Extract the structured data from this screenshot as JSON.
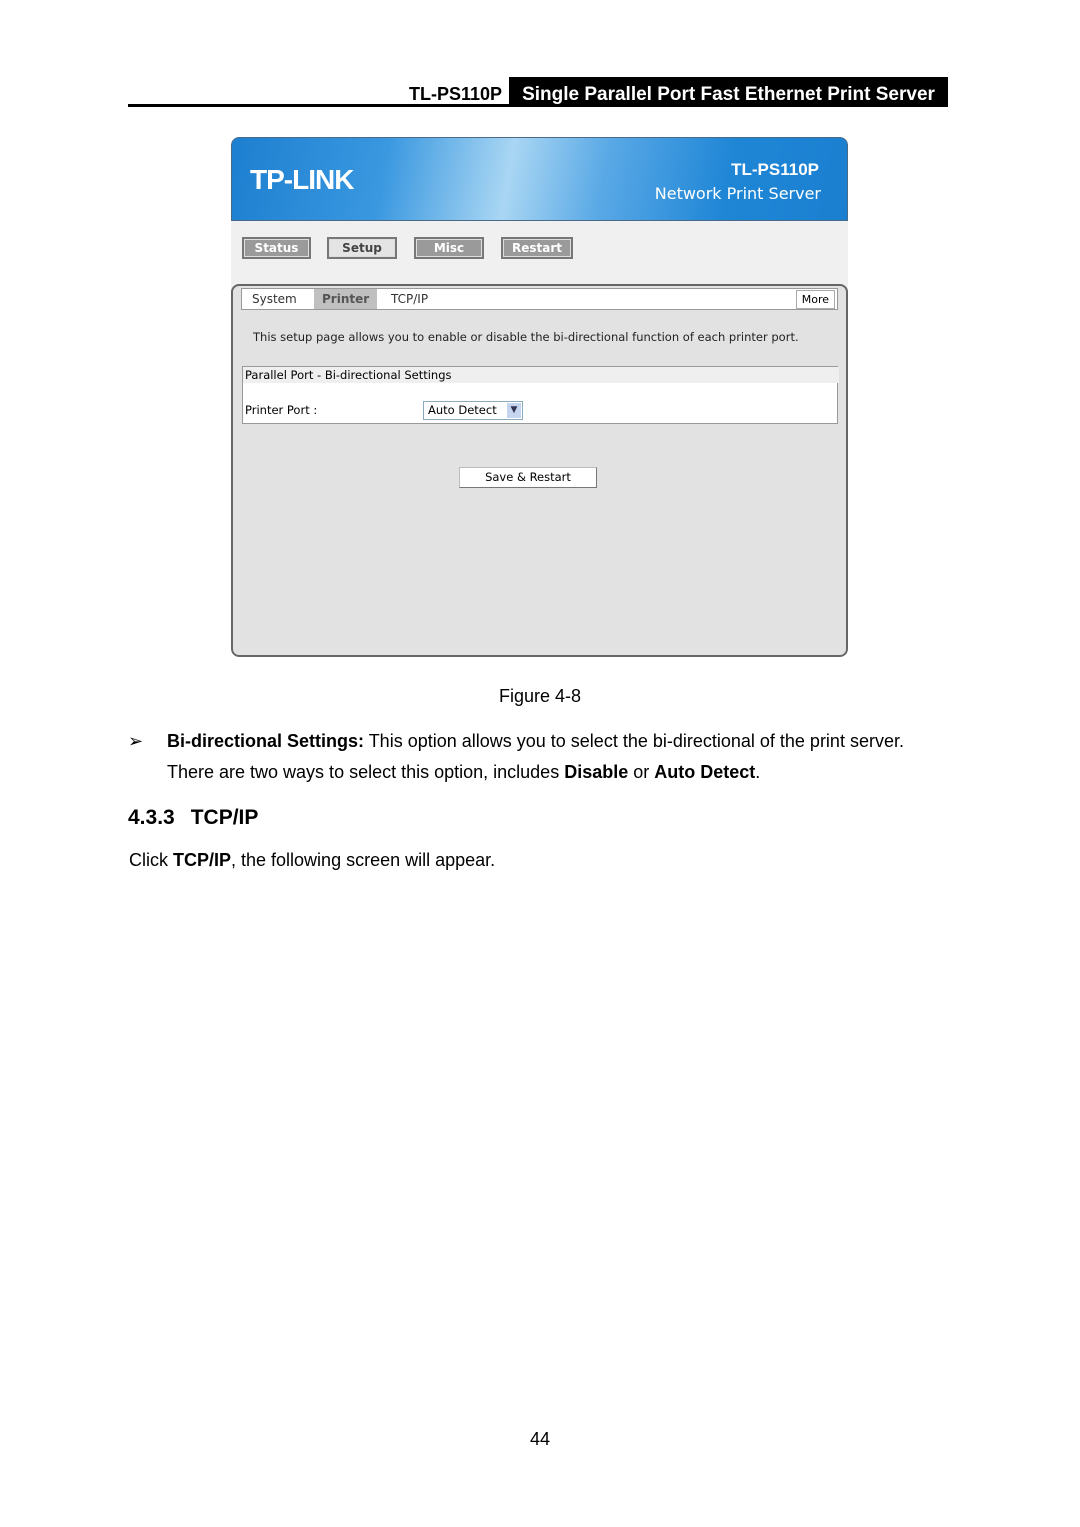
{
  "header": {
    "model": "TL-PS110P",
    "title": "Single Parallel Port Fast Ethernet Print Server"
  },
  "screenshot": {
    "logo": "TP-LINK",
    "model": "TL-PS110P",
    "product": "Network Print Server",
    "nav": [
      "Status",
      "Setup",
      "Misc",
      "Restart"
    ],
    "active_nav": "Setup",
    "tabs": [
      "System",
      "Printer",
      "TCP/IP"
    ],
    "active_tab": "Printer",
    "more": "More",
    "description": "This setup page allows you to enable or disable the bi-directional function of each printer port.",
    "section_title": "Parallel Port - Bi-directional Settings",
    "printer_port_label": "Printer Port :",
    "printer_port_value": "Auto Detect",
    "save_button": "Save & Restart"
  },
  "figure_caption": "Figure 4-8",
  "bullet": {
    "term": "Bi-directional Settings:",
    "text1": " This option allows you to select the bi-directional of the print server.",
    "text2": "There are two ways to select this option, includes ",
    "opt1": "Disable",
    "or": " or ",
    "opt2": "Auto Detect",
    "end": "."
  },
  "section": {
    "number": "4.3.3",
    "title": "TCP/IP"
  },
  "click": {
    "pre": "Click ",
    "bold": "TCP/IP",
    "post": ", the following screen will appear."
  },
  "page_number": "44"
}
